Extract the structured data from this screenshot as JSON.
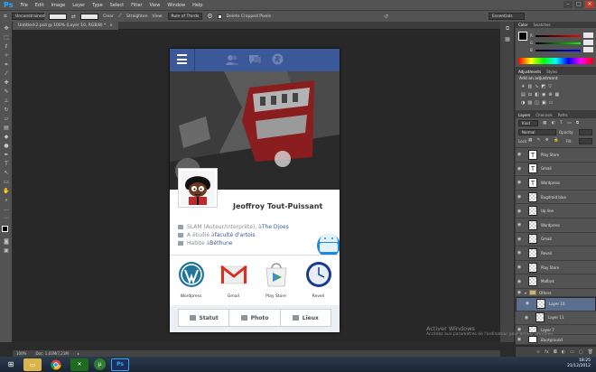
{
  "menubar": {
    "logo": "Ps",
    "items": [
      "File",
      "Edit",
      "Image",
      "Layer",
      "Type",
      "Select",
      "Filter",
      "View",
      "Window",
      "Help"
    ]
  },
  "options": {
    "style": "Unconstrained",
    "clear": "Clear",
    "straighten": "Straighten",
    "view_label": "View:",
    "view_value": "Rule of Thirds",
    "delete_cropped": "Delete Cropped Pixels",
    "workspace": "Essentials"
  },
  "doc_tab": {
    "title": "Untitled-2.psd @ 100% (Layer 10, RGB/8) *",
    "close": "×"
  },
  "profile": {
    "name": "Jeoffroy Tout-Puissant",
    "info": [
      {
        "text": "SLAM (Auteur/Interprète), à ",
        "link": "The Djoes"
      },
      {
        "text": "A étudié à ",
        "link": "faculté d'artois"
      },
      {
        "text": "Habite à ",
        "link": "Béthune"
      }
    ]
  },
  "apps": [
    {
      "label": "Wordpress",
      "icon": "wordpress-icon",
      "color": "#21759b"
    },
    {
      "label": "Gmail",
      "icon": "gmail-icon",
      "color": "#d93025"
    },
    {
      "label": "Play Store",
      "icon": "play-store-icon",
      "color": "#34a853"
    },
    {
      "label": "Reveil",
      "icon": "clock-icon",
      "color": "#1a3a8f"
    }
  ],
  "actions": [
    {
      "label": "Statut",
      "icon": "edit-icon"
    },
    {
      "label": "Photo",
      "icon": "camera-icon"
    },
    {
      "label": "Lieux",
      "icon": "location-icon"
    }
  ],
  "panels": {
    "color_tab": "Color",
    "swatches_tab": "Swatches",
    "rgb": [
      "R",
      "G",
      "B"
    ],
    "adjustments_tab": "Adjustments",
    "styles_tab": "Styles",
    "add_adjustment": "Add an adjustment",
    "layers_tab": "Layers",
    "channels_tab": "Channels",
    "paths_tab": "Paths",
    "kind_label": "Kind",
    "blend_mode": "Normal",
    "opacity_label": "Opacity:",
    "lock_label": "Lock:",
    "fill_label": "Fill:"
  },
  "layers": [
    {
      "name": "Play Store",
      "thumb": "T"
    },
    {
      "name": "Gmail",
      "thumb": "T"
    },
    {
      "name": "Wordpress",
      "thumb": "T"
    },
    {
      "name": "Bugdroid blue",
      "thumb": ""
    },
    {
      "name": "Up line",
      "thumb": ""
    },
    {
      "name": "Wordpress",
      "thumb": ""
    },
    {
      "name": "Gmail",
      "thumb": ""
    },
    {
      "name": "Reveil",
      "thumb": ""
    },
    {
      "name": "Play Store",
      "thumb": ""
    },
    {
      "name": "Maflark",
      "thumb": ""
    },
    {
      "name": "Others",
      "thumb": ""
    },
    {
      "name": "Layer 10",
      "thumb": ""
    },
    {
      "name": "Layer 11",
      "thumb": ""
    },
    {
      "name": "Layer 7",
      "thumb": ""
    },
    {
      "name": "Background",
      "thumb": ""
    }
  ],
  "status": {
    "zoom": "100%",
    "doc": "Doc: 1,03M/7,21M"
  },
  "watermark": {
    "line1": "Activer Windows",
    "line2": "Accédez aux paramètres de l'ordinateur pour activer Windows."
  },
  "clock": {
    "time": "18:25",
    "date": "21/12/2012"
  }
}
